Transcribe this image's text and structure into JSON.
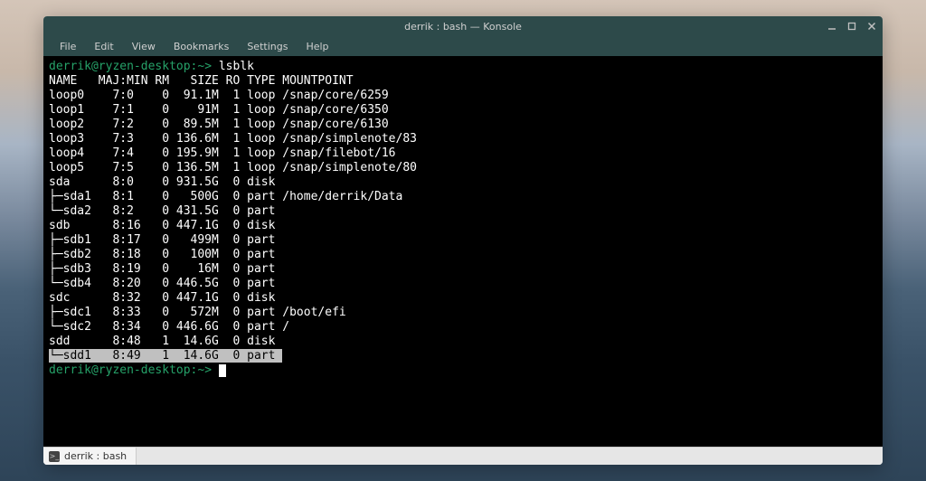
{
  "window": {
    "title": "derrik : bash — Konsole"
  },
  "menu": {
    "file": "File",
    "edit": "Edit",
    "view": "View",
    "bookmarks": "Bookmarks",
    "settings": "Settings",
    "help": "Help"
  },
  "prompt": {
    "user": "derrik",
    "host": "ryzen-desktop",
    "path": "~",
    "command": "lsblk"
  },
  "lsblk": {
    "header": "NAME   MAJ:MIN RM   SIZE RO TYPE MOUNTPOINT",
    "rows": [
      "loop0    7:0    0  91.1M  1 loop /snap/core/6259",
      "loop1    7:1    0    91M  1 loop /snap/core/6350",
      "loop2    7:2    0  89.5M  1 loop /snap/core/6130",
      "loop3    7:3    0 136.6M  1 loop /snap/simplenote/83",
      "loop4    7:4    0 195.9M  1 loop /snap/filebot/16",
      "loop5    7:5    0 136.5M  1 loop /snap/simplenote/80",
      "sda      8:0    0 931.5G  0 disk ",
      "├─sda1   8:1    0   500G  0 part /home/derrik/Data",
      "└─sda2   8:2    0 431.5G  0 part ",
      "sdb      8:16   0 447.1G  0 disk ",
      "├─sdb1   8:17   0   499M  0 part ",
      "├─sdb2   8:18   0   100M  0 part ",
      "├─sdb3   8:19   0    16M  0 part ",
      "└─sdb4   8:20   0 446.5G  0 part ",
      "sdc      8:32   0 447.1G  0 disk ",
      "├─sdc1   8:33   0   572M  0 part /boot/efi",
      "└─sdc2   8:34   0 446.6G  0 part /",
      "sdd      8:48   1  14.6G  0 disk "
    ],
    "highlighted": "└─sdd1   8:49   1  14.6G  0 part "
  },
  "tab": {
    "label": "derrik : bash"
  }
}
